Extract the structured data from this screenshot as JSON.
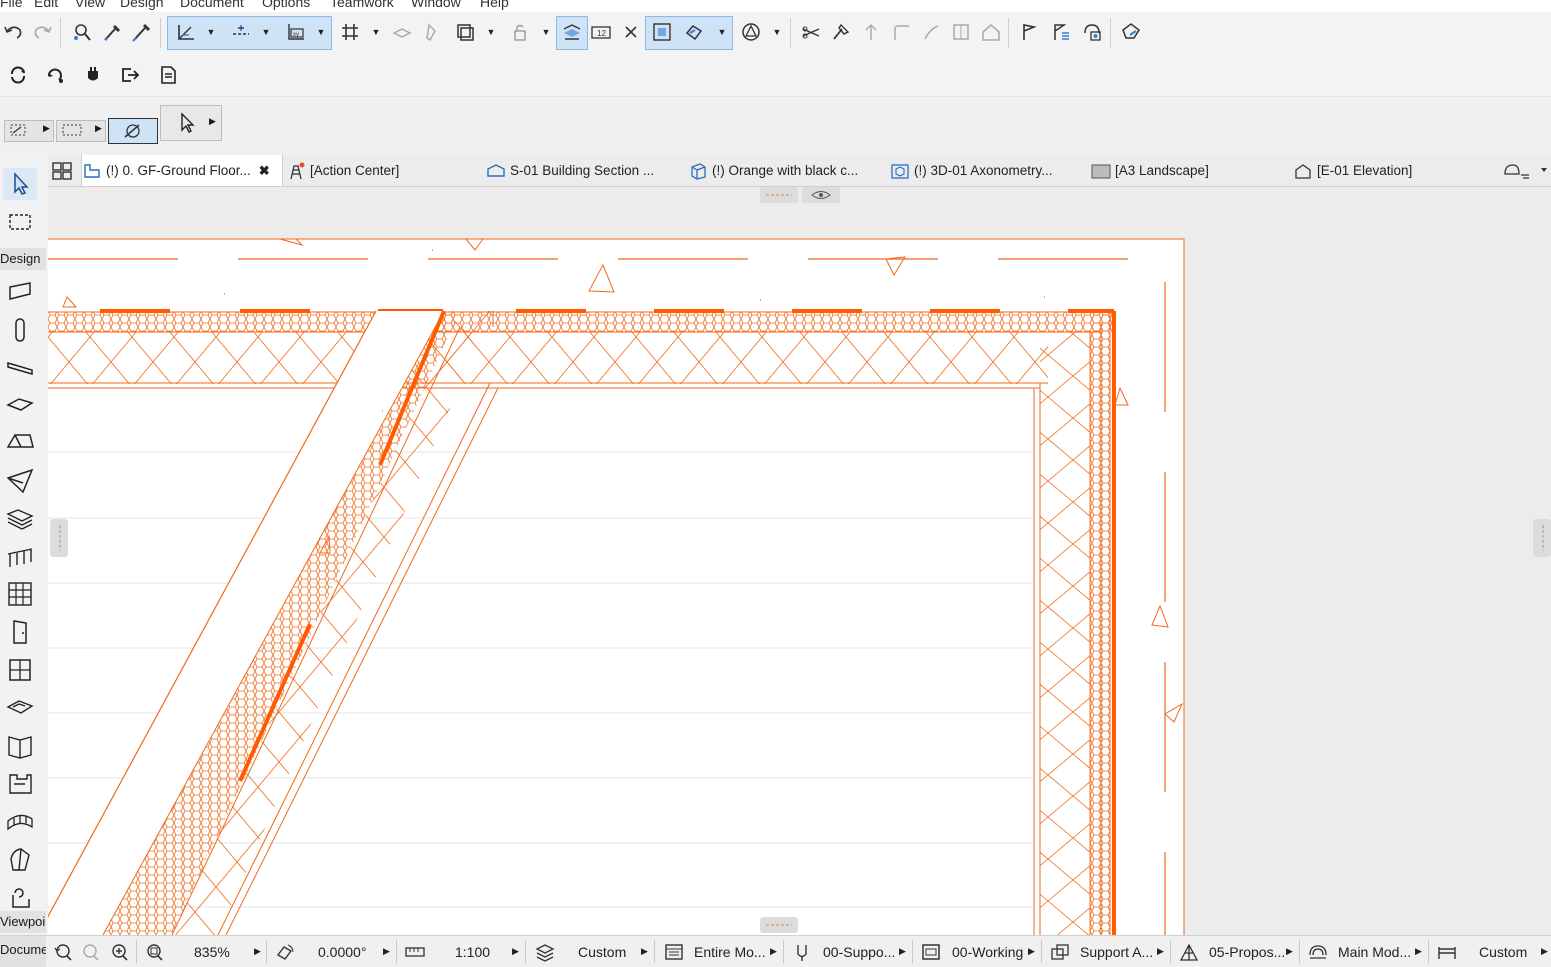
{
  "menu": [
    "File",
    "Edit",
    "View",
    "Design",
    "Document",
    "Options",
    "Teamwork",
    "Window",
    "Help"
  ],
  "tabs": [
    {
      "label": "(!) 0. GF-Ground Floor...",
      "icon": "floor-plan-icon",
      "active": true,
      "close": "✖"
    },
    {
      "label": "[Action Center]",
      "icon": "action-center-icon"
    },
    {
      "label": "S-01 Building Section ...",
      "icon": "section-icon"
    },
    {
      "label": "(!) Orange with black c...",
      "icon": "3d-view-icon"
    },
    {
      "label": "(!) 3D-01 Axonometry...",
      "icon": "axonometry-icon"
    },
    {
      "label": "[A3 Landscape]",
      "icon": "layout-icon"
    },
    {
      "label": "[E-01 Elevation]",
      "icon": "elevation-icon"
    }
  ],
  "toolbox": {
    "design_label": "Design",
    "viewpoint_label": "Viewpoir",
    "document_label": "Documei"
  },
  "status": {
    "zoom": "835%",
    "angle": "0.0000°",
    "scale": "1:100",
    "layer_combo": "Custom",
    "model_view": "Entire Mo...",
    "pen_set": "00-Suppo...",
    "graphic_override": "00-Working",
    "renovation": "Support A...",
    "structure": "05-Propos...",
    "partial_structure": "Main Mod...",
    "dimension": "Custom"
  },
  "colors": {
    "drawing": "#f06a1a",
    "drawing_bold": "#ff5a00",
    "active_bg": "#cfe3f7",
    "canvas_bg": "#ececec",
    "paper": "#ffffff"
  }
}
